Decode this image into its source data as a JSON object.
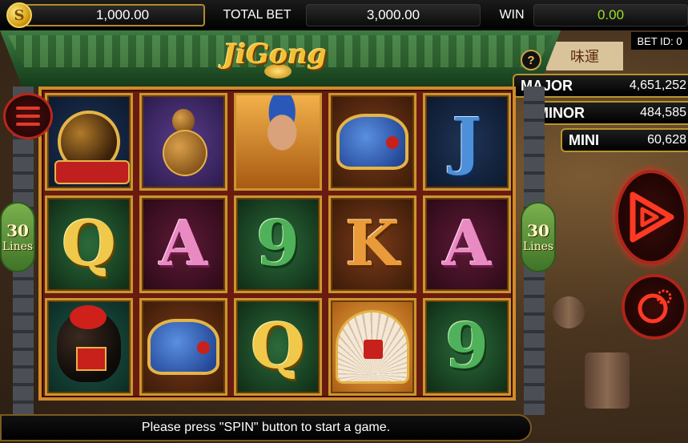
{
  "topbar": {
    "coin_glyph": "S",
    "balance": "1,000.00",
    "total_bet_label": "TOTAL BET",
    "total_bet": "3,000.00",
    "win_label": "WIN",
    "win": "0.00"
  },
  "header": {
    "logo": "JiGong",
    "bet_id": "BET ID: 0",
    "help_glyph": "?"
  },
  "jackpots": {
    "major_label": "MAJOR",
    "major_value": "4,651,252",
    "minor_label": "MINOR",
    "minor_value": "484,585",
    "mini_label": "MINI",
    "mini_value": "60,628"
  },
  "side": {
    "lines_count": "30",
    "lines_text": "Lines"
  },
  "reels": [
    [
      "pot-symbol",
      "Q-symbol",
      "wine-jar-symbol"
    ],
    [
      "gourd-symbol",
      "A-symbol",
      "hat-symbol"
    ],
    [
      "monk-symbol",
      "9-symbol",
      "Q-symbol"
    ],
    [
      "hat-symbol",
      "K-symbol",
      "fan-symbol"
    ],
    [
      "J-symbol",
      "A-symbol",
      "9-symbol"
    ]
  ],
  "reel_letters": {
    "r1_2": "Q",
    "r2_2": "A",
    "r3_2": "9",
    "r3_3": "Q",
    "r4_2": "K",
    "r5_1": "J",
    "r5_2": "A",
    "r5_3": "9"
  },
  "message": "Please press \"SPIN\" button to start a game.",
  "colors": {
    "win_value": "#9be024",
    "frame_gold": "#c9962f",
    "spin_red": "#e0301f",
    "roof_green": "#3e7a43"
  },
  "icons": {
    "menu": "hamburger-menu-icon",
    "spin": "play-triangle-icon",
    "auto": "gear-cycle-icon",
    "coin": "coin-icon"
  }
}
